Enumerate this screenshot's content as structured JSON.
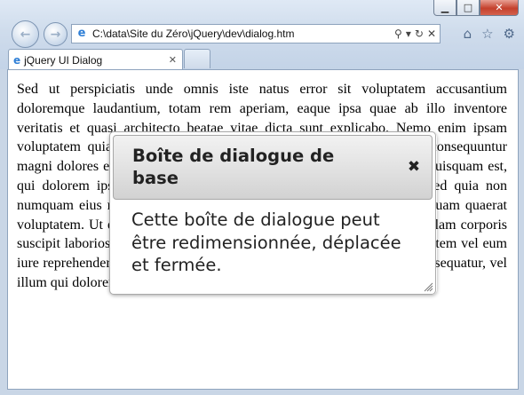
{
  "browser": {
    "address": "C:\\data\\Site du Zéro\\jQuery\\dev\\dialog.htm",
    "tab_title": "jQuery UI Dialog",
    "window_controls": [
      "minimize",
      "maximize",
      "close"
    ]
  },
  "page": {
    "paragraph": "Sed ut perspiciatis unde omnis iste natus error sit voluptatem accusantium doloremque laudantium, totam rem aperiam, eaque ipsa quae ab illo inventore veritatis et quasi architecto beatae vitae dicta sunt explicabo. Nemo enim ipsam voluptatem quia voluptas sit aspernatur aut odit aut fugit, sed quia consequuntur magni dolores eos qui ratione voluptatem sequi nesciunt. Neque porro quisquam est, qui dolorem ipsum quia dolor sit amet, consectetur, adipisci velit, sed quia non numquam eius modi tempora incidunt ut labore et dolore magnam aliquam quaerat voluptatem. Ut enim ad minima veniam, quis nostrum exercitationem ullam corporis suscipit laboriosam, nisi ut aliquid ex ea commodi consequatur? Quis autem vel eum iure reprehenderit qui in ea voluptate velit esse quam nihil molestiae consequatur, vel illum qui dolorem eum fugiat quo voluptas nulla pariatur?"
  },
  "dialog": {
    "title": "Boîte de dialogue de base",
    "body": "Cette boîte de dialogue peut être redimensionnée, déplacée et fermée."
  },
  "colors": {
    "dialog_header_top": "#f2f2f2",
    "dialog_header_bottom": "#d2d2d2",
    "close_button": "#c4402c"
  }
}
